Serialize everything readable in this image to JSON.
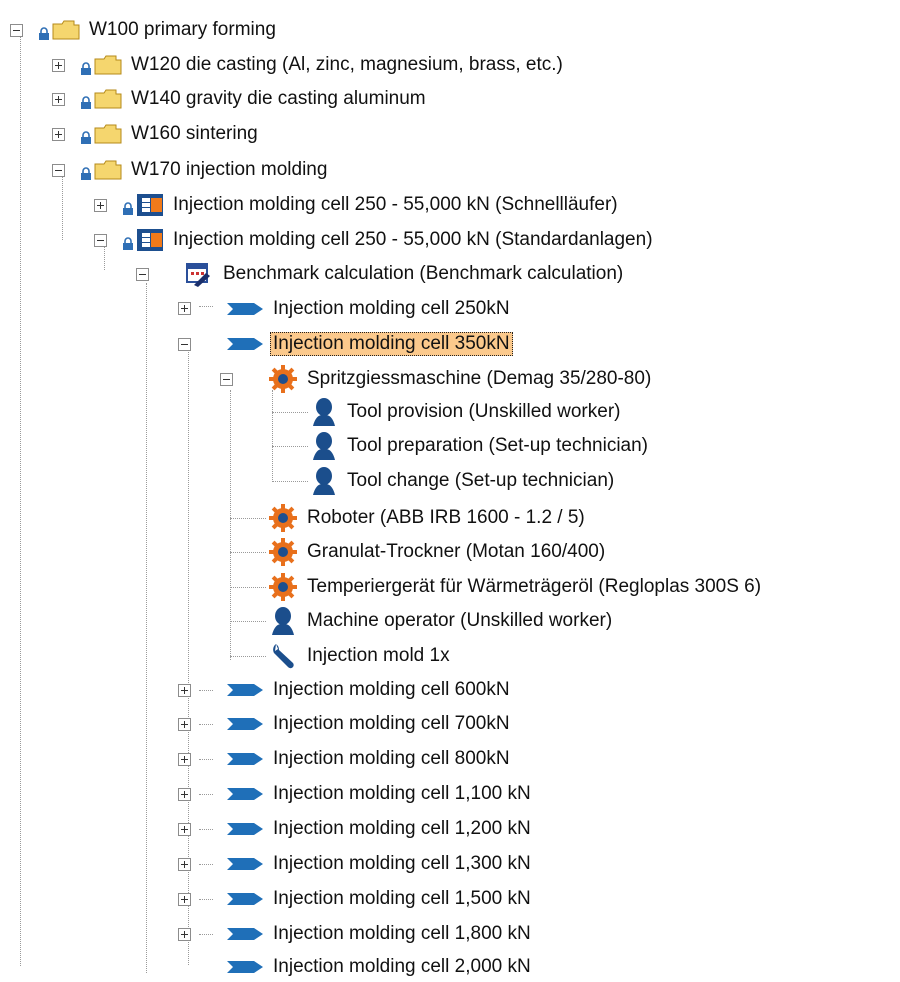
{
  "tree": {
    "root": {
      "label": "W100 primary forming"
    },
    "folders": [
      {
        "label": "W120 die casting (Al, zinc, magnesium, brass, etc.)"
      },
      {
        "label": "W140 gravity die casting aluminum"
      },
      {
        "label": "W160 sintering"
      },
      {
        "label": "W170 injection molding"
      }
    ],
    "cells": [
      {
        "label": "Injection molding cell 250 - 55,000 kN (Schnellläufer)"
      },
      {
        "label": "Injection molding cell 250 - 55,000 kN (Standardanlagen)"
      }
    ],
    "benchmark": {
      "label": "Benchmark calculation (Benchmark calculation)"
    },
    "variants_top": [
      {
        "label": "Injection molding  cell 250kN"
      },
      {
        "label": "Injection molding  cell 350kN"
      }
    ],
    "machine": {
      "label": "Spritzgiessmaschine (Demag 35/280-80)"
    },
    "workers": [
      {
        "label": "Tool provision (Unskilled worker)"
      },
      {
        "label": "Tool preparation (Set-up technician)"
      },
      {
        "label": "Tool change (Set-up technician)"
      }
    ],
    "components": [
      {
        "label": "Roboter (ABB IRB 1600 - 1.2 / 5)",
        "icon": "gear-icon"
      },
      {
        "label": "Granulat-Trockner (Motan 160/400)",
        "icon": "gear-icon"
      },
      {
        "label": "Temperiergerät für Wärmeträgeröl (Regloplas 300S 6)",
        "icon": "gear-icon"
      },
      {
        "label": "Machine operator (Unskilled worker)",
        "icon": "worker-icon"
      },
      {
        "label": "Injection mold 1x",
        "icon": "wrench-icon"
      }
    ],
    "variants_bottom": [
      {
        "label": "Injection molding  cell 600kN"
      },
      {
        "label": "Injection molding  cell 700kN"
      },
      {
        "label": "Injection molding  cell 800kN"
      },
      {
        "label": "Injection molding  cell 1,100 kN"
      },
      {
        "label": "Injection molding  cell 1,200 kN"
      },
      {
        "label": "Injection molding  cell 1,300 kN"
      },
      {
        "label": "Injection molding  cell 1,500 kN"
      },
      {
        "label": "Injection molding  cell 1,800 kN"
      },
      {
        "label": "Injection molding  cell 2,000 kN"
      }
    ],
    "selected": "Injection molding  cell 350kN",
    "colors": {
      "selection": "#fbc98c",
      "folder": "#f5d66e",
      "lock": "#2f6fb5",
      "arrow": "#1f6fb8",
      "gear": "#e8701c",
      "cell_orange": "#f07a1a"
    }
  }
}
